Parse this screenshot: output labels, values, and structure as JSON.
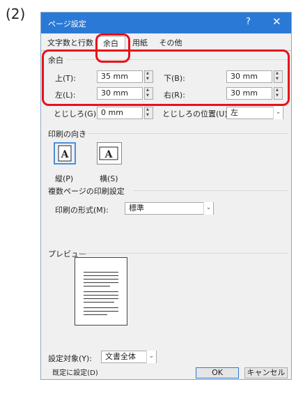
{
  "step_label": "(2)",
  "dialog": {
    "title": "ページ設定",
    "help": "?",
    "close": "✕",
    "tabs": [
      "文字数と行数",
      "余白",
      "用紙",
      "その他"
    ],
    "margins": {
      "section_label": "余白",
      "top_label": "上(T):",
      "top_value": "35 mm",
      "bottom_label": "下(B):",
      "bottom_value": "30 mm",
      "left_label": "左(L):",
      "left_value": "30 mm",
      "right_label": "右(R):",
      "right_value": "30 mm",
      "gutter_label": "とじしろ(G):",
      "gutter_value": "0 mm",
      "gutter_pos_label": "とじしろの位置(U):",
      "gutter_pos_value": "左"
    },
    "orientation": {
      "section_label": "印刷の向き",
      "portrait_label": "縦(P)",
      "landscape_label": "横(S)",
      "icon_letter": "A"
    },
    "multiple_pages": {
      "section_label": "複数ページの印刷設定",
      "format_label": "印刷の形式(M):",
      "format_value": "標準"
    },
    "preview": {
      "section_label": "プレビュー"
    },
    "apply_to": {
      "label": "設定対象(Y):",
      "value": "文書全体"
    },
    "buttons": {
      "default": "既定に設定(D)",
      "ok": "OK",
      "cancel": "キャンセル"
    }
  },
  "colors": {
    "titlebar": "#2b79d6",
    "highlight": "#e8101b"
  }
}
